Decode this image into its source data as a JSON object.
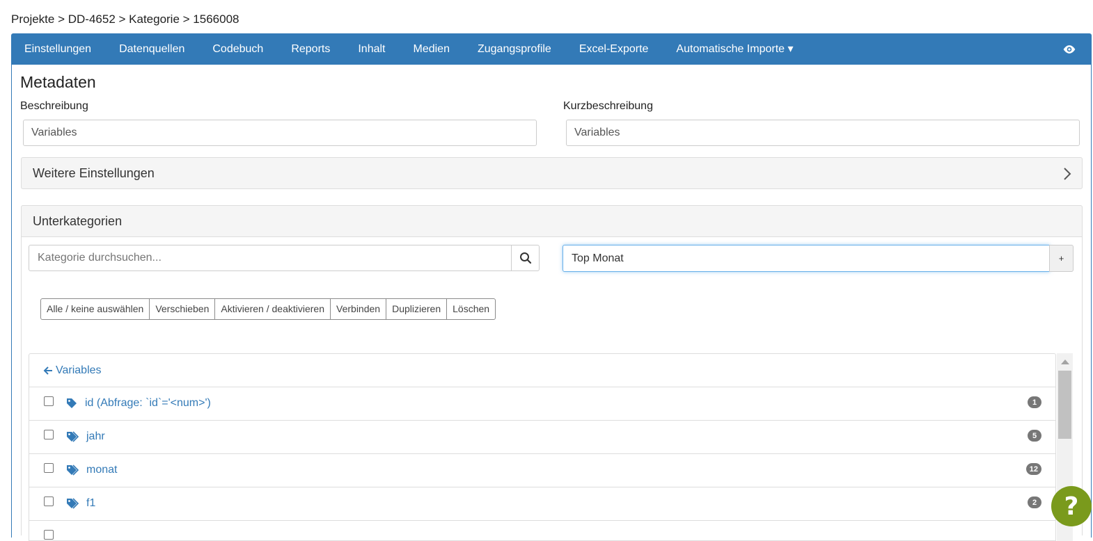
{
  "breadcrumb": "Projekte > DD-4652 > Kategorie > 1566008",
  "nav": {
    "items": [
      "Einstellungen",
      "Datenquellen",
      "Codebuch",
      "Reports",
      "Inhalt",
      "Medien",
      "Zugangsprofile",
      "Excel-Exporte",
      "Automatische Importe"
    ],
    "dropdown_indicator": "▾",
    "eye_icon": "eye-icon"
  },
  "metadata": {
    "title": "Metadaten",
    "description_label": "Beschreibung",
    "description_value": "Variables",
    "short_label": "Kurzbeschreibung",
    "short_value": "Variables"
  },
  "more_settings": {
    "title": "Weitere Einstellungen"
  },
  "subcategories": {
    "title": "Unterkategorien",
    "search_placeholder": "Kategorie durchsuchen...",
    "new_value": "Top Monat",
    "add_label": "+",
    "actions": [
      "Alle / keine auswählen",
      "Verschieben",
      "Aktivieren / deaktivieren",
      "Verbinden",
      "Duplizieren",
      "Löschen"
    ],
    "back_label": "Variables",
    "rows": [
      {
        "label": "id (Abfrage: `id`='<num>')",
        "count": "1",
        "icon": "tag-icon"
      },
      {
        "label": "jahr",
        "count": "5",
        "icon": "tags-icon"
      },
      {
        "label": "monat",
        "count": "12",
        "icon": "tags-icon"
      },
      {
        "label": "f1",
        "count": "2",
        "icon": "tags-icon"
      },
      {
        "label": "",
        "count": "",
        "icon": "tags-icon"
      }
    ]
  },
  "help": {
    "label": "?"
  },
  "colors": {
    "primary": "#337ab7",
    "badge": "#777777",
    "help": "#7a9a1c"
  }
}
